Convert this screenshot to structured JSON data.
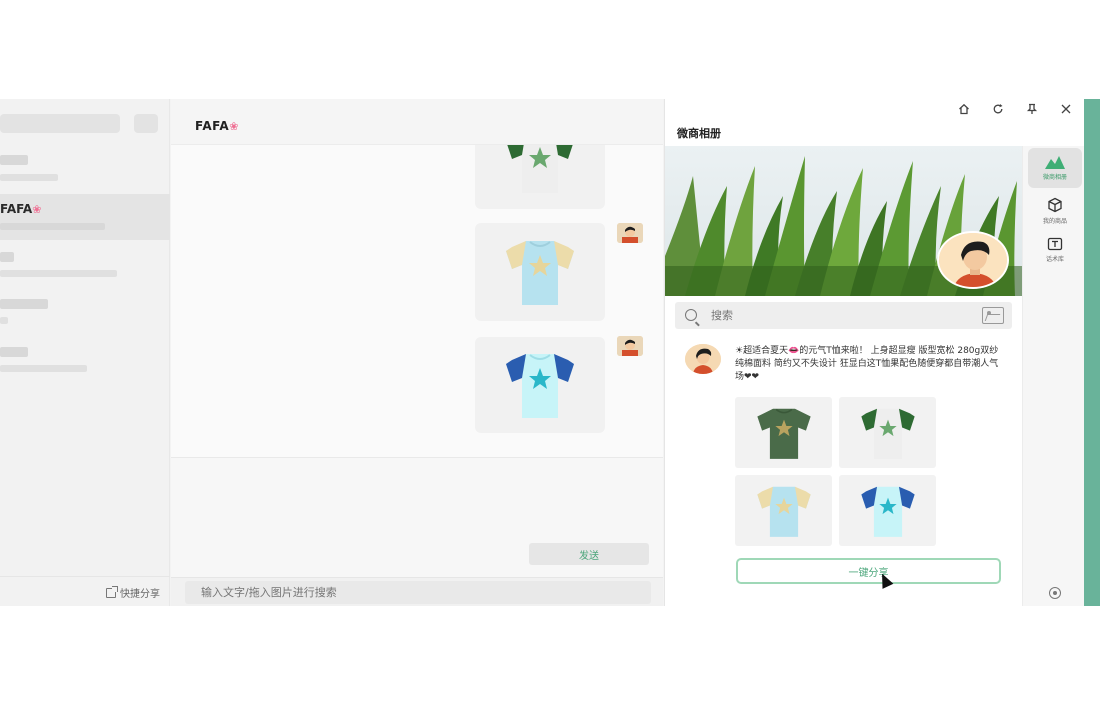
{
  "sidebar": {
    "active_conversation": "FAFA",
    "quick_share_label": "快捷分享"
  },
  "chat": {
    "title": "FAFA",
    "send_label": "发送",
    "search_placeholder": "输入文字/拖入图片进行搜索"
  },
  "panel": {
    "title": "微商相册",
    "search_placeholder": "搜索",
    "post_text": "☀超适合夏天👄的元气T恤来啦！ 上身超显瘦 版型宽松 280g双纱纯棉面料 简约又不失设计 狂显白这T恤果配色随便穿都自带潮人气场❤❤",
    "share_all_label": "一键分享"
  },
  "tools": [
    {
      "label": "微商相册",
      "icon": "album-icon",
      "active": true
    },
    {
      "label": "我的商品",
      "icon": "box-icon",
      "active": false
    },
    {
      "label": "话术库",
      "icon": "script-library-icon",
      "active": false
    }
  ],
  "colors": {
    "accent": "#4aa57a",
    "edge": "#69b39a"
  }
}
